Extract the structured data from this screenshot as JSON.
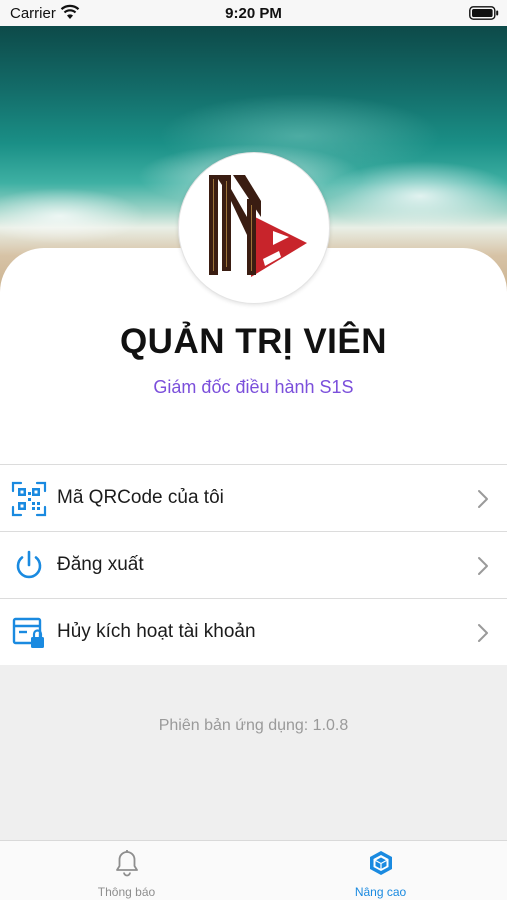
{
  "status_bar": {
    "carrier": "Carrier",
    "time": "9:20 PM"
  },
  "profile": {
    "name": "QUẢN TRỊ VIÊN",
    "role": "Giám đốc điều hành S1S"
  },
  "menu": {
    "items": [
      {
        "label": "Mã QRCode của tôi",
        "icon": "qrcode-icon"
      },
      {
        "label": "Đăng xuất",
        "icon": "power-icon"
      },
      {
        "label": "Hủy kích hoạt tài khoản",
        "icon": "deactivate-account-icon"
      }
    ]
  },
  "footer": {
    "version_text": "Phiên bản ứng dụng: 1.0.8"
  },
  "tab_bar": {
    "tabs": [
      {
        "label": "Thông báo",
        "icon": "bell-icon",
        "active": false
      },
      {
        "label": "Nâng cao",
        "icon": "cube-icon",
        "active": true
      }
    ]
  },
  "colors": {
    "accent": "#1a8ae0",
    "role_text": "#7b4fdb",
    "logo_dark": "#3a1d12",
    "logo_red": "#c8242b"
  }
}
